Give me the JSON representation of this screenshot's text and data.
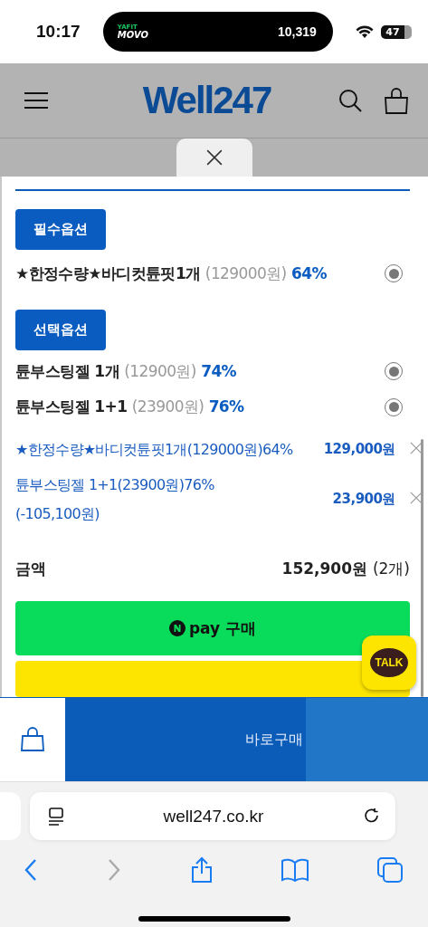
{
  "status_bar": {
    "time": "10:17",
    "island": {
      "brand_top": "YAFIT",
      "brand": "MOVO",
      "steps": "10,319"
    },
    "battery": "47"
  },
  "header": {
    "logo": "Well247"
  },
  "required_section": {
    "label": "필수옵션",
    "options": [
      {
        "name": "★한정수량★바디컷튠핏1개",
        "price": "(129000원)",
        "discount": "64%",
        "selected": true
      }
    ]
  },
  "optional_section": {
    "label": "선택옵션",
    "options": [
      {
        "name": "튠부스팅젤 1개",
        "price": "(12900원)",
        "discount": "74%",
        "selected": true
      },
      {
        "name": "튠부스팅젤 1+1",
        "price": "(23900원)",
        "discount": "76%",
        "selected": true
      }
    ]
  },
  "cart_items": [
    {
      "name": "★한정수량★바디컷튠핏1개(129000원)64%",
      "price": "129,000원"
    },
    {
      "name": "튠부스팅젤 1+1(23900원)76%",
      "note": "(-105,100원)",
      "price": "23,900원"
    }
  ],
  "total": {
    "label": "금액",
    "amount": "152,900원",
    "count": "(2개)"
  },
  "npay_button": {
    "label": "pay",
    "action": "구매"
  },
  "kakao": {
    "label": "TALK"
  },
  "bottom_bar": {
    "buy_label": "바로구매"
  },
  "browser": {
    "url": "well247.co.kr"
  }
}
